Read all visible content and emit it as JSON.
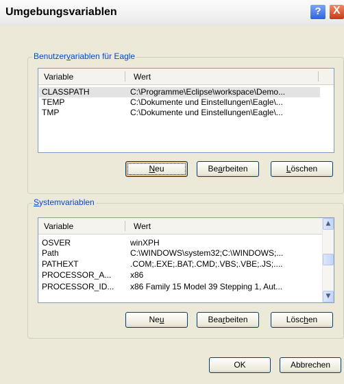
{
  "window": {
    "title": "Umgebungsvariablen",
    "help_label": "?",
    "close_label": "X"
  },
  "user_vars": {
    "legend_pre": "Benutzer",
    "legend_accel": "v",
    "legend_post": "ariablen für Eagle",
    "columns": [
      "Variable",
      "Wert"
    ],
    "rows": [
      {
        "var": "CLASSPATH",
        "val": "C:\\Programme\\Eclipse\\workspace\\Demo...",
        "selected": true
      },
      {
        "var": "TEMP",
        "val": "C:\\Dokumente und Einstellungen\\Eagle\\..."
      },
      {
        "var": "TMP",
        "val": "C:\\Dokumente und Einstellungen\\Eagle\\..."
      }
    ],
    "buttons": {
      "new_accel": "N",
      "new_rest": "eu",
      "edit_pre": "Be",
      "edit_accel": "a",
      "edit_post": "rbeiten",
      "delete_accel": "L",
      "delete_rest": "öschen"
    }
  },
  "system_vars": {
    "legend_accel": "S",
    "legend_rest": "ystemvariablen",
    "columns": [
      "Variable",
      "Wert"
    ],
    "rows": [
      {
        "var": "OSVER",
        "val": "winXPH"
      },
      {
        "var": "Path",
        "val": "C:\\WINDOWS\\system32;C:\\WINDOWS;..."
      },
      {
        "var": "PATHEXT",
        "val": ".COM;.EXE;.BAT;.CMD;.VBS;.VBE;.JS;...."
      },
      {
        "var": "PROCESSOR_A...",
        "val": "x86"
      },
      {
        "var": "PROCESSOR_ID...",
        "val": "x86 Family 15 Model 39 Stepping 1, Aut..."
      }
    ],
    "buttons": {
      "new_pre": "Ne",
      "new_accel": "u",
      "edit_pre": "Bea",
      "edit_accel": "r",
      "edit_post": "beiten",
      "delete_pre": "Lösc",
      "delete_accel": "h",
      "delete_post": "en"
    }
  },
  "footer": {
    "ok_label": "OK",
    "cancel_label": "Abbrechen"
  },
  "icons": {
    "scroll_up": "chevron-up-icon",
    "scroll_down": "chevron-down-icon"
  }
}
